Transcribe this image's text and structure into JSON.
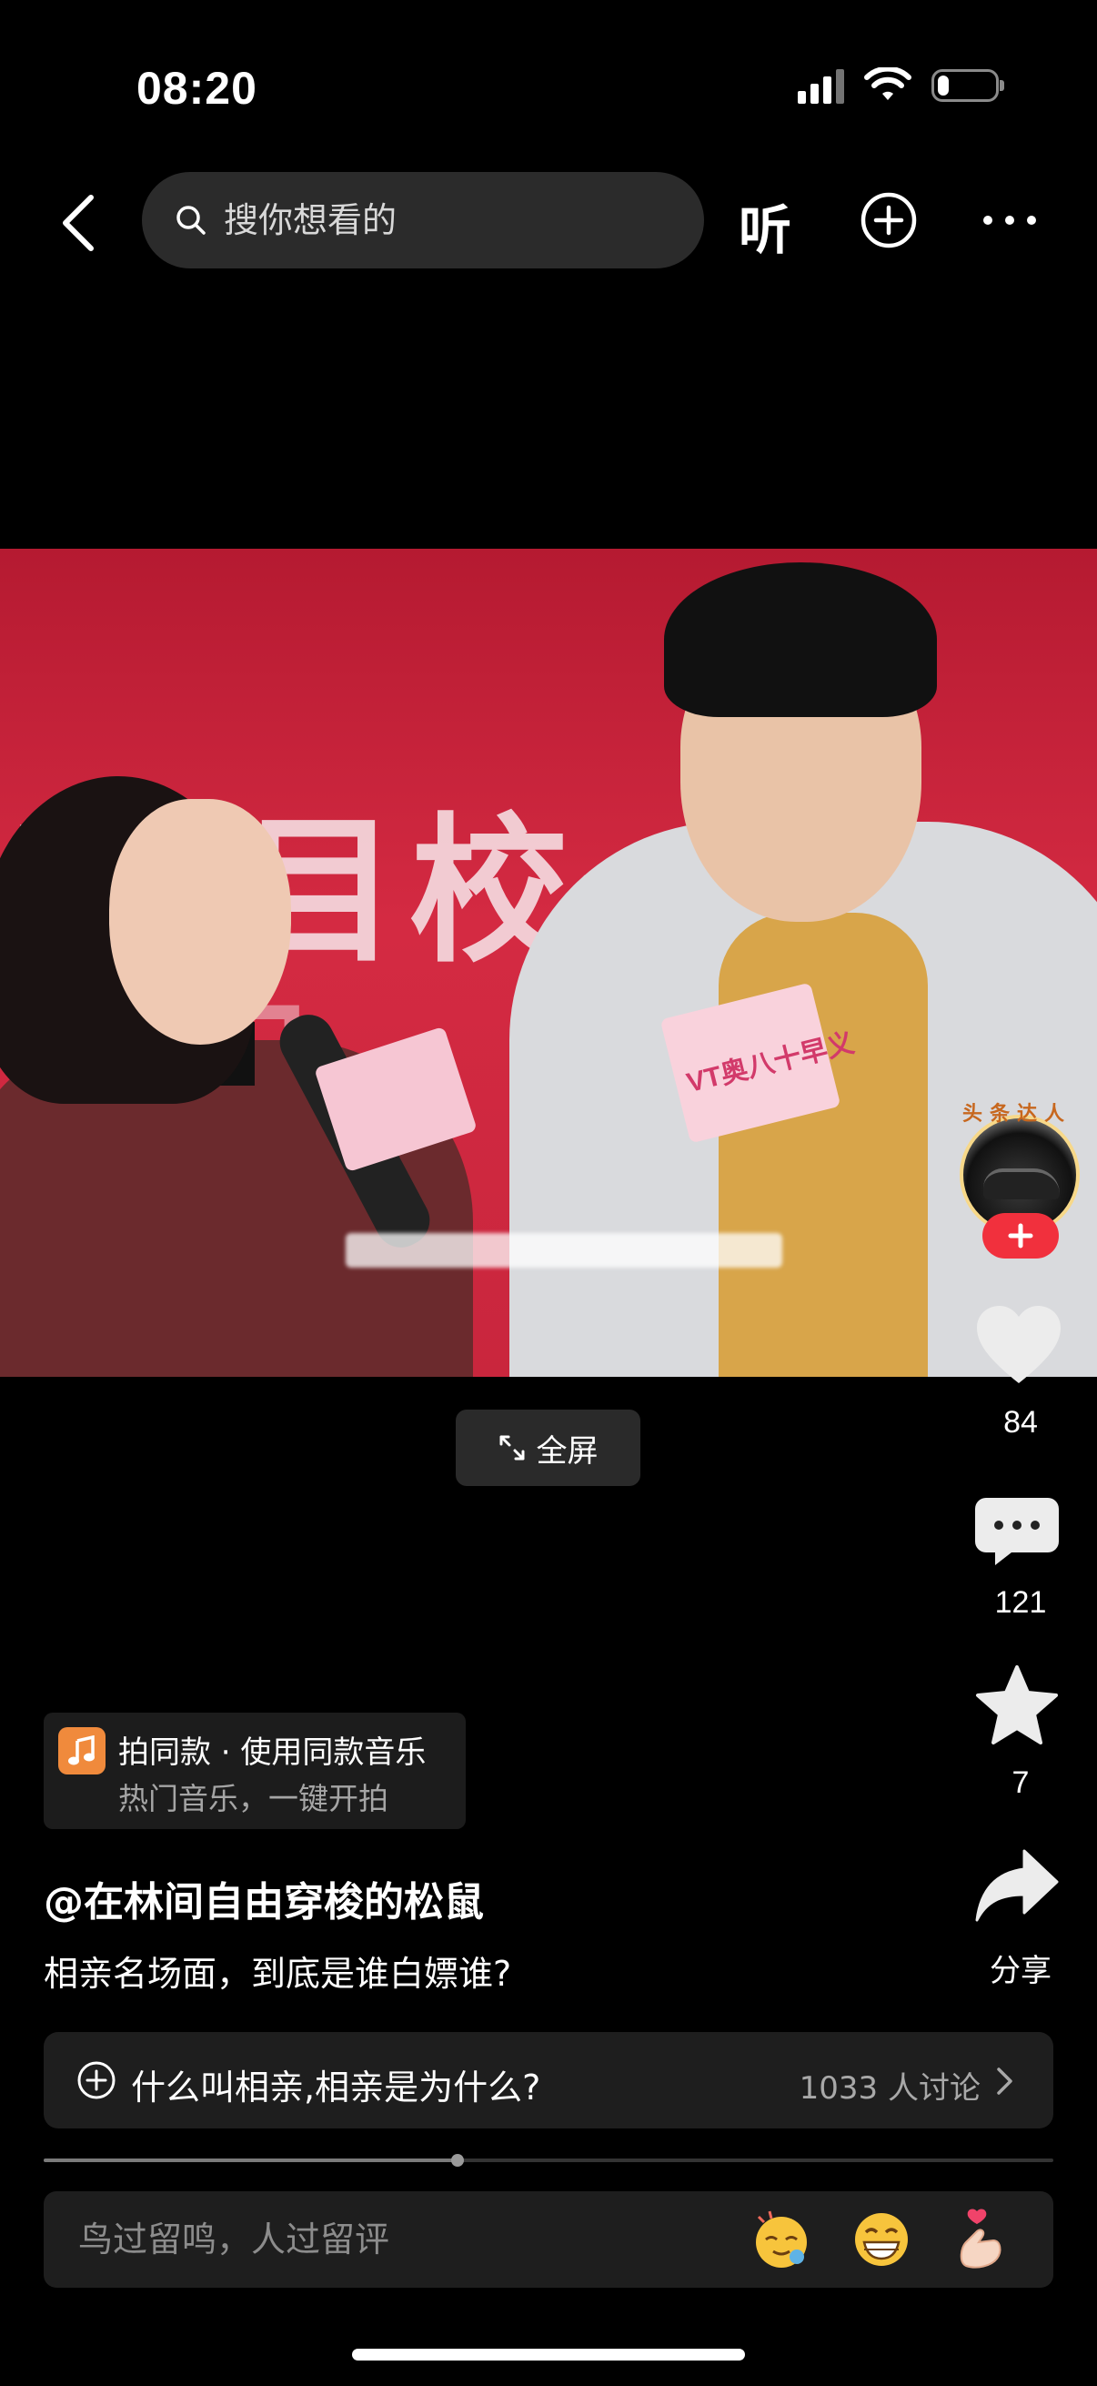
{
  "status_bar": {
    "time": "08:20",
    "battery_level": 0.2
  },
  "header": {
    "back_icon": "chevron-left-icon",
    "search_placeholder": "搜你想看的",
    "listen_label": "听",
    "add_icon": "plus-circle-icon",
    "more_icon": "more-horizontal-icon"
  },
  "video": {
    "badge_text": "VT奥八十早义",
    "fullscreen_label": "全屏"
  },
  "right_rail": {
    "avatar_badge": "头条达人",
    "like_count": "84",
    "comment_count": "121",
    "favorite_count": "7",
    "share_label": "分享"
  },
  "music": {
    "title": "拍同款 · 使用同款音乐",
    "subtitle": "热门音乐，一键开拍"
  },
  "post": {
    "author": "@在林间自由穿梭的松鼠",
    "caption": "相亲名场面，到底是谁白嫖谁?"
  },
  "topic": {
    "title": "什么叫相亲,相亲是为什么?",
    "discussion": "1033 人讨论"
  },
  "playback": {
    "progress": 0.41
  },
  "comment_bar": {
    "placeholder": "鸟过留鸣，人过留评",
    "emojis": [
      "hug-emoji",
      "grin-emoji",
      "finger-heart-emoji"
    ]
  },
  "colors": {
    "accent_red": "#f1303d",
    "music_orange": "#f08a3c"
  }
}
